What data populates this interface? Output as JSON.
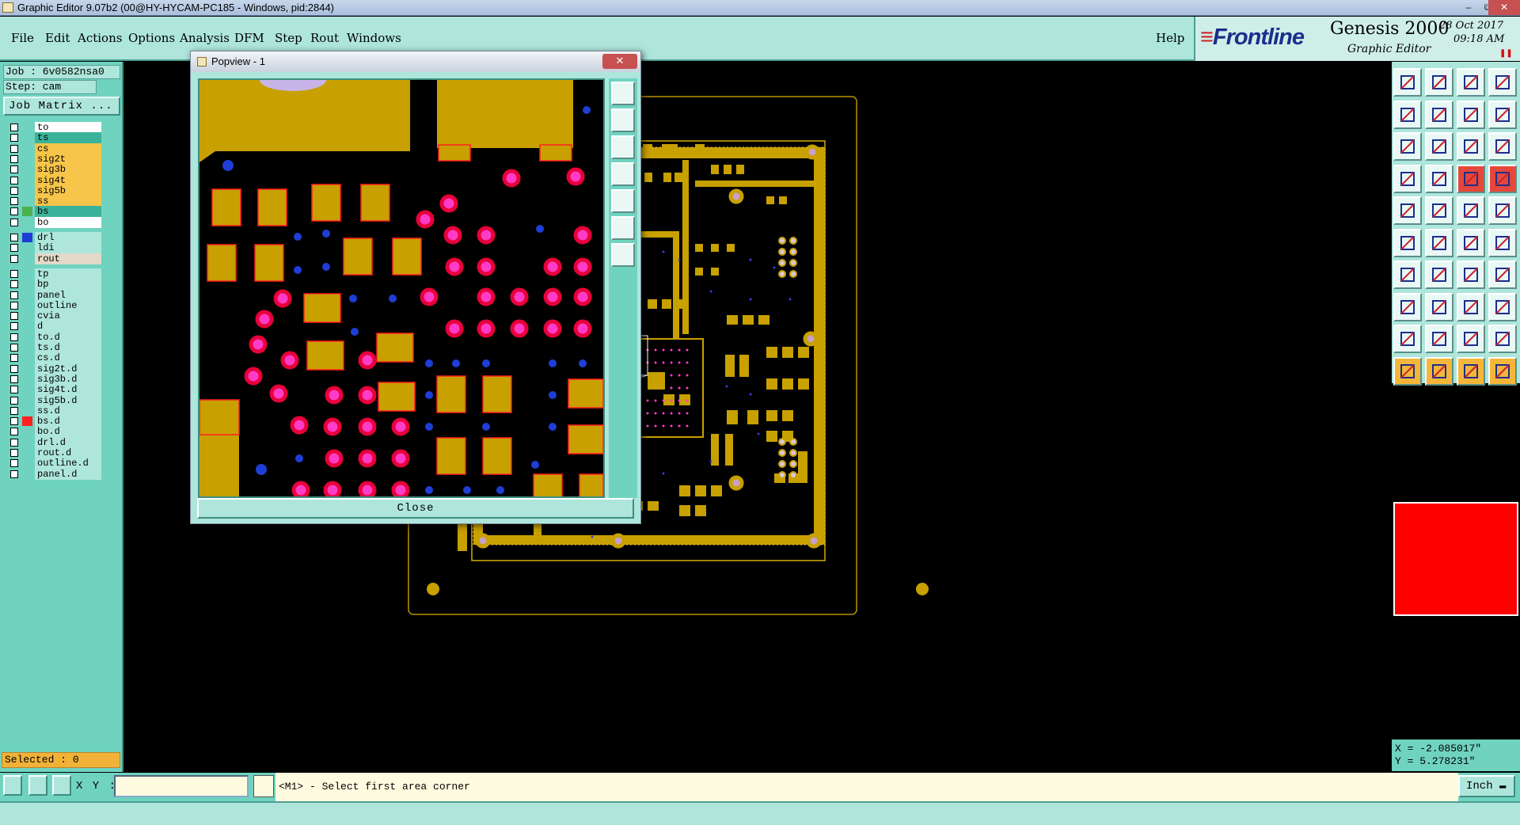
{
  "window": {
    "title": "Graphic Editor 9.07b2 (00@HY-HYCAM-PC185 - Windows, pid:2844)"
  },
  "menubar": {
    "items": [
      {
        "label": "File"
      },
      {
        "label": "Edit"
      },
      {
        "label": "Actions"
      },
      {
        "label": "Options"
      },
      {
        "label": "Analysis"
      },
      {
        "label": "DFM"
      },
      {
        "label": "Step"
      },
      {
        "label": "Rout"
      },
      {
        "label": "Windows"
      }
    ],
    "help": "Help"
  },
  "brand": {
    "logo": "Frontline",
    "product": "Genesis 2000",
    "subtitle": "Graphic Editor",
    "date": "28 Oct 2017",
    "time": "09:18 AM"
  },
  "left_panel": {
    "job": "Job : 6v0582nsa0",
    "step": "Step: cam",
    "job_matrix": "Job Matrix ...",
    "selected": "Selected : 0",
    "layers": [
      {
        "name": "to",
        "bg": "#ffffff",
        "swatch": ""
      },
      {
        "name": "ts",
        "bg": "#3bb39a",
        "swatch": ""
      },
      {
        "name": "cs",
        "bg": "#f6c54a",
        "swatch": ""
      },
      {
        "name": "sig2t",
        "bg": "#f6c54a",
        "swatch": ""
      },
      {
        "name": "sig3b",
        "bg": "#f6c54a",
        "swatch": ""
      },
      {
        "name": "sig4t",
        "bg": "#f6c54a",
        "swatch": ""
      },
      {
        "name": "sig5b",
        "bg": "#f6c54a",
        "swatch": ""
      },
      {
        "name": "ss",
        "bg": "#f6c54a",
        "swatch": ""
      },
      {
        "name": "bs",
        "bg": "#3bb39a",
        "swatch": "#4caf50"
      },
      {
        "name": "bo",
        "bg": "#ffffff",
        "swatch": ""
      },
      {
        "name": "drl",
        "bg": "#aee6dc",
        "swatch": "#1f3ed6"
      },
      {
        "name": "ldi",
        "bg": "#aee6dc",
        "swatch": ""
      },
      {
        "name": "rout",
        "bg": "#e3d9c8",
        "swatch": ""
      },
      {
        "name": "tp",
        "bg": "#aee6dc",
        "swatch": ""
      },
      {
        "name": "bp",
        "bg": "#aee6dc",
        "swatch": ""
      },
      {
        "name": "panel",
        "bg": "#aee6dc",
        "swatch": ""
      },
      {
        "name": "outline",
        "bg": "#aee6dc",
        "swatch": ""
      },
      {
        "name": "cvia",
        "bg": "#aee6dc",
        "swatch": ""
      },
      {
        "name": "d",
        "bg": "#aee6dc",
        "swatch": ""
      },
      {
        "name": "to.d",
        "bg": "#aee6dc",
        "swatch": ""
      },
      {
        "name": "ts.d",
        "bg": "#aee6dc",
        "swatch": ""
      },
      {
        "name": "cs.d",
        "bg": "#aee6dc",
        "swatch": ""
      },
      {
        "name": "sig2t.d",
        "bg": "#aee6dc",
        "swatch": ""
      },
      {
        "name": "sig3b.d",
        "bg": "#aee6dc",
        "swatch": ""
      },
      {
        "name": "sig4t.d",
        "bg": "#aee6dc",
        "swatch": ""
      },
      {
        "name": "sig5b.d",
        "bg": "#aee6dc",
        "swatch": ""
      },
      {
        "name": "ss.d",
        "bg": "#aee6dc",
        "swatch": ""
      },
      {
        "name": "bs.d",
        "bg": "#aee6dc",
        "swatch": "#ff2020"
      },
      {
        "name": "bo.d",
        "bg": "#aee6dc",
        "swatch": ""
      },
      {
        "name": "drl.d",
        "bg": "#aee6dc",
        "swatch": ""
      },
      {
        "name": "rout.d",
        "bg": "#aee6dc",
        "swatch": ""
      },
      {
        "name": "outline.d",
        "bg": "#aee6dc",
        "swatch": ""
      },
      {
        "name": "panel.d",
        "bg": "#aee6dc",
        "swatch": ""
      }
    ]
  },
  "popview": {
    "title": "Popview - 1",
    "close_label": "Close"
  },
  "coords": {
    "x": "X = -2.085017\"",
    "y": "Y = 5.278231\""
  },
  "bottom": {
    "xy_label": "X Y :",
    "xy_value": "",
    "prompt": "<M1> - Select first area corner",
    "units": "Inch"
  },
  "colors": {
    "copper": "#c8a000",
    "pad_red": "#e8003a",
    "pad_magenta": "#ff3cc8",
    "drill_blue": "#1f3ed6",
    "panel_teal": "#6fd3c0",
    "panel_light": "#aee6dc"
  }
}
